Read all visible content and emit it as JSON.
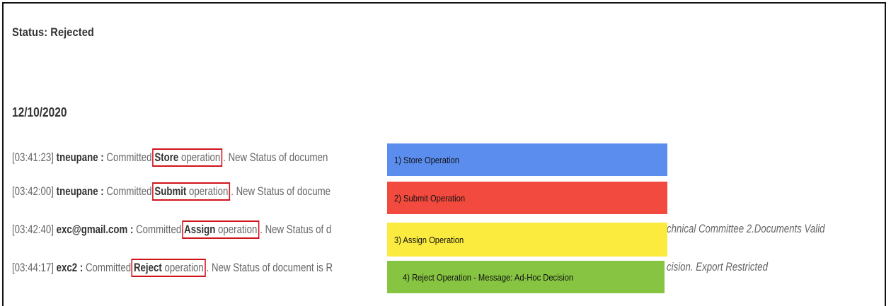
{
  "status": {
    "text": "Status: Rejected"
  },
  "date": "12/10/2020",
  "log": [
    {
      "time": "[03:41:23]",
      "user": "tneupane",
      "sep": " : ",
      "committed": "Committed",
      "op": "Store",
      "op_suffix": "operation",
      "after": ". New Status of documen",
      "tail": ""
    },
    {
      "time": "[03:42:00]",
      "user": "tneupane",
      "sep": " : ",
      "committed": "Committed",
      "op": "Submit",
      "op_suffix": "operation",
      "after": ". New Status of docume",
      "tail": ""
    },
    {
      "time": "[03:42:40]",
      "user": "exc@gmail.com",
      "sep": " : ",
      "committed": "Committed",
      "op": "Assign",
      "op_suffix": "operation",
      "after": ". New Status of d",
      "tail": "chnical Committee 2.Documents Valid"
    },
    {
      "time": "[03:44:17]",
      "user": "exc2",
      "sep": " : ",
      "committed": "Committed",
      "op": "Reject",
      "op_suffix": "operation",
      "after": ". New Status of document is R",
      "tail": "cision. Export Restricted"
    }
  ],
  "legend": [
    {
      "label": "1) Store Operation",
      "color": "#5b8def"
    },
    {
      "label": "2) Submit Operation",
      "color": "#f24a3f"
    },
    {
      "label": "3) Assign Operation",
      "color": "#fbeb3f"
    },
    {
      "label": "4) Reject Operation - Message: Ad-Hoc Decision",
      "color": "#86c441"
    }
  ]
}
